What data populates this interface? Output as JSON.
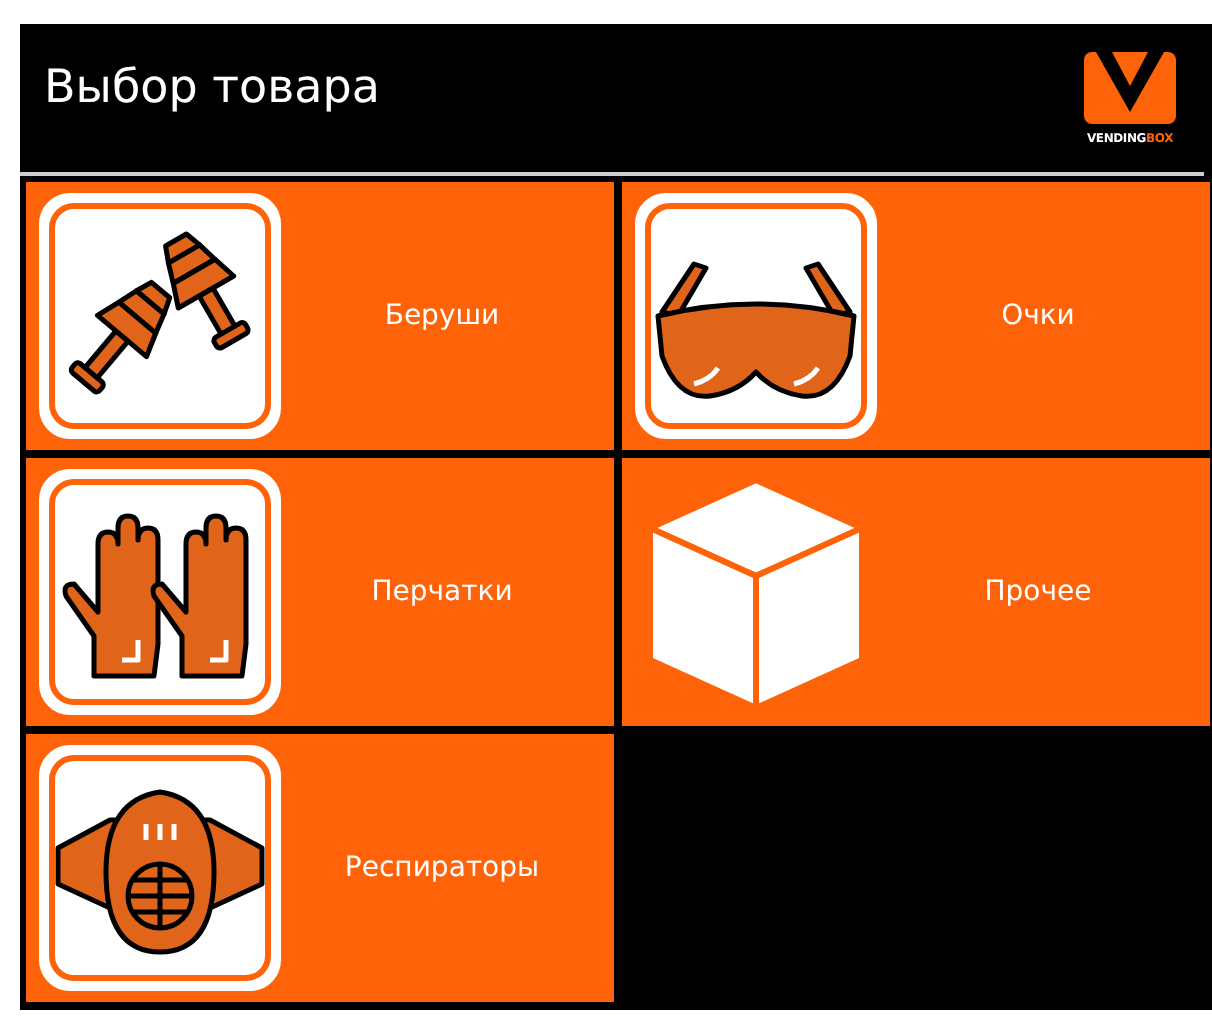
{
  "header": {
    "title": "Выбор товара",
    "logo": {
      "text_main": "VENDING",
      "text_accent": "BOX"
    }
  },
  "categories": [
    {
      "label": "Беруши",
      "kind": "earplugs"
    },
    {
      "label": "Очки",
      "kind": "glasses"
    },
    {
      "label": "Перчатки",
      "kind": "gloves"
    },
    {
      "label": "Прочее",
      "kind": "box"
    },
    {
      "label": "Респираторы",
      "kind": "respirator"
    }
  ]
}
